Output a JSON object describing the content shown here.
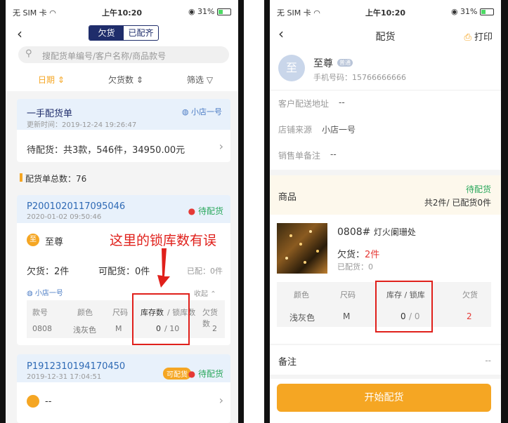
{
  "status": {
    "carrier": "无 SIM 卡",
    "time": "上午10:20",
    "battery": "31%"
  },
  "left": {
    "tabs": [
      {
        "label": "欠货",
        "active": true
      },
      {
        "label": "已配齐",
        "active": false
      }
    ],
    "search_placeholder": "搜配货单编号/客户名称/商品款号",
    "filters": {
      "date": "日期",
      "owe": "欠货数",
      "filter": "筛选"
    },
    "summary": {
      "title": "一手配货单",
      "store": "小店一号",
      "updated": "更新时间：2019-12-24 19:26:47",
      "pending": "待配货：共3款，546件，34950.00元"
    },
    "total_label": "配货单总数：76",
    "order1": {
      "id": "P2001020117095046",
      "status": "待配货",
      "date": "2020-01-02 09:50:46",
      "avatar": "至",
      "customer": "至尊",
      "owe": "欠货：2件",
      "available": "可配货：0件",
      "shipped": "已配：0件",
      "store": "小店一号",
      "collapse": "收起",
      "headers": [
        "款号",
        "颜色",
        "尺码",
        "库存数",
        "/ 锁库数",
        "欠货数"
      ],
      "row": [
        "0808",
        "浅灰色",
        "M",
        "0",
        "/ 10",
        "2"
      ]
    },
    "annotation": "这里的锁库数有误",
    "order2": {
      "id": "P1912310194170450",
      "badge": "可配货",
      "status": "待配货",
      "date": "2019-12-31 17:04:51",
      "customer": "--"
    }
  },
  "right": {
    "title": "配货",
    "print": "打印",
    "avatar": "至",
    "customer": "至尊",
    "tag": "普通",
    "phone": "手机号码：15766666666",
    "fields": [
      {
        "label": "客户配送地址",
        "value": "--"
      },
      {
        "label": "店铺来源",
        "value": "小店一号"
      },
      {
        "label": "销售单备注",
        "value": "--"
      }
    ],
    "goods_label": "商品",
    "goods_status": "待配货",
    "goods_summary": "共2件/ 已配货0件",
    "product": {
      "code": "0808#",
      "name": "灯火阑珊处",
      "owe_label": "欠货：",
      "owe_value": "2件",
      "shipped": "已配货：0"
    },
    "headers": [
      "颜色",
      "尺码",
      "库存 / 锁库",
      "欠货"
    ],
    "row": [
      "浅灰色",
      "M",
      "0",
      "/ 0",
      "2"
    ],
    "remark_label": "备注",
    "remark_value": "--",
    "start_button": "开始配货"
  },
  "colors": {
    "accent": "#f5a623",
    "navy": "#1f2d6b",
    "green": "#2aa85c",
    "red": "#e53935",
    "highlight": "#e0201b"
  }
}
